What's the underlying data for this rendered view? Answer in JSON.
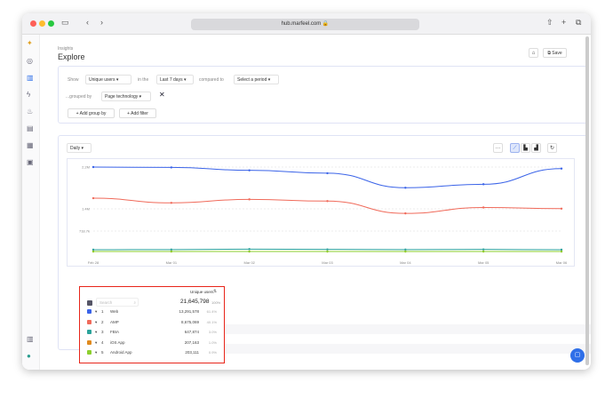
{
  "browser": {
    "url": "hub.marfeel.com"
  },
  "page": {
    "breadcrumb": "Insights",
    "title": "Explore",
    "save_label": "Save"
  },
  "query": {
    "show_label": "Show",
    "metric": "Unique users",
    "in_the_label": "in the",
    "period": "Last 7 days",
    "compared_label": "compared to",
    "compare": "Select a period",
    "grouped_label": "...grouped by",
    "group": "Page technology",
    "add_group": "+ Add group by",
    "add_filter": "+ Add filter"
  },
  "chart_controls": {
    "granularity": "Daily"
  },
  "colors": {
    "web": "#3a63e8",
    "amp": "#f06a5a",
    "fbia": "#2aa39a",
    "ios": "#e08a1e",
    "android": "#8ccf2e",
    "accent": "#2f6fe8"
  },
  "chart_data": {
    "type": "line",
    "categories": [
      "Feb 28",
      "Mar 01",
      "Mar 02",
      "Mar 03",
      "Mar 04",
      "Mar 05",
      "Mar 06"
    ],
    "yticks": [
      "718.7k",
      "1.4M",
      "2.2M"
    ],
    "ytick_values": [
      718700,
      1437000,
      2156000
    ],
    "series": [
      {
        "name": "Web",
        "color": "#3a63e8",
        "values": [
          2156000,
          2150000,
          2100000,
          2050000,
          1800000,
          1860000,
          2130000
        ]
      },
      {
        "name": "AMP",
        "color": "#f06a5a",
        "values": [
          1620000,
          1540000,
          1600000,
          1570000,
          1290000,
          1460000,
          1440000
        ]
      },
      {
        "name": "FBIA",
        "color": "#2aa39a",
        "values": [
          90000,
          95000,
          110000,
          100000,
          95000,
          100000,
          90000
        ]
      },
      {
        "name": "iOS App",
        "color": "#e08a1e",
        "values": [
          30000,
          30000,
          30000,
          30000,
          30000,
          30000,
          30000
        ]
      },
      {
        "name": "Android App",
        "color": "#8ccf2e",
        "values": [
          29000,
          29000,
          29000,
          29000,
          29000,
          29000,
          29000
        ]
      }
    ]
  },
  "table": {
    "header": "Unique users",
    "search_placeholder": "Search",
    "total": "21,645,798",
    "total_pct": "100%",
    "rows": [
      {
        "rank": "1",
        "name": "Web",
        "value": "13,291,578",
        "pct": "61.4%"
      },
      {
        "rank": "2",
        "name": "AMP",
        "value": "8,675,069",
        "pct": "40.1%"
      },
      {
        "rank": "3",
        "name": "FBIA",
        "value": "647,874",
        "pct": "3.0%"
      },
      {
        "rank": "4",
        "name": "iOS App",
        "value": "207,163",
        "pct": "1.0%"
      },
      {
        "rank": "5",
        "name": "Android App",
        "value": "203,111",
        "pct": "0.9%"
      }
    ]
  }
}
